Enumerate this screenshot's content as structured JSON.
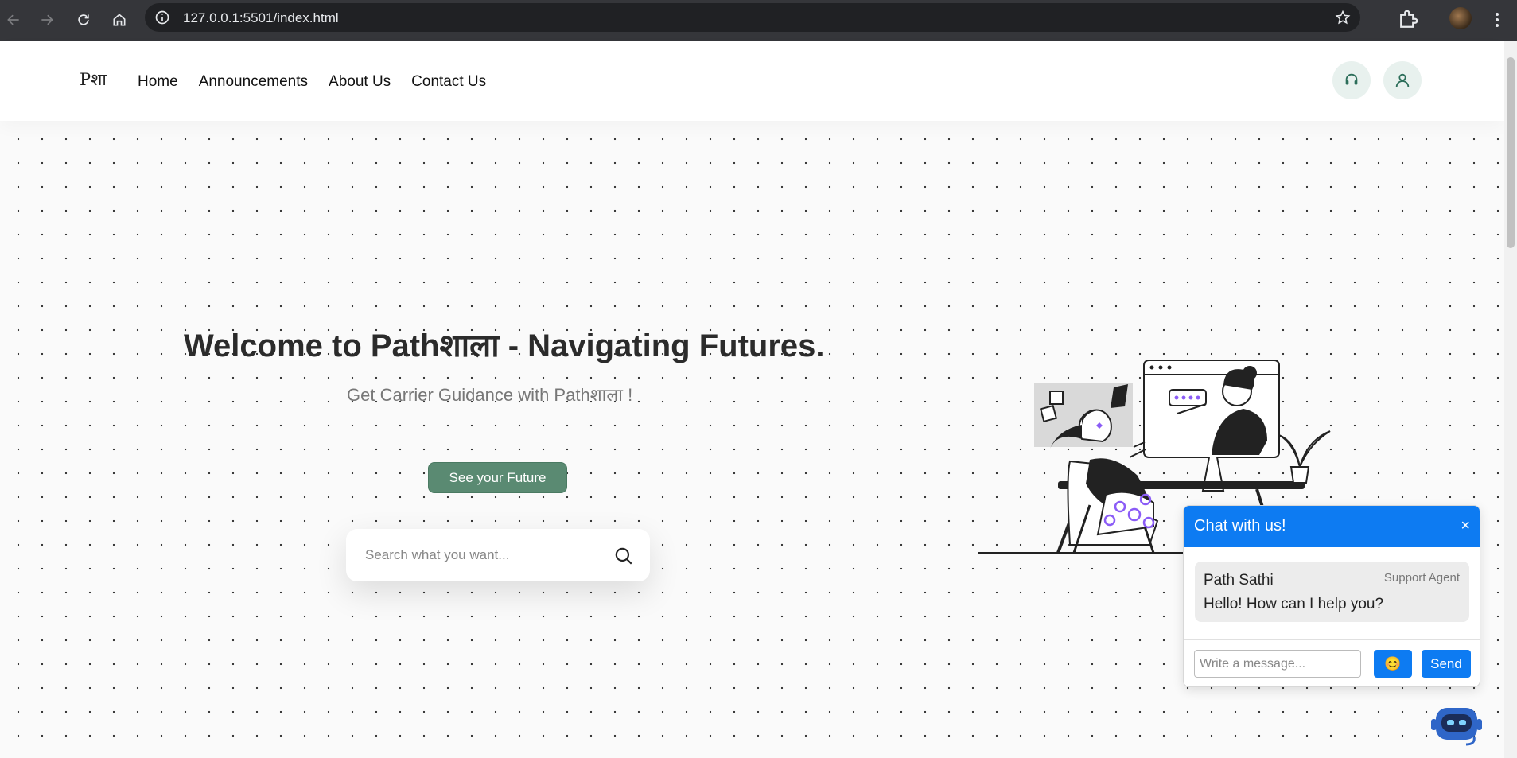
{
  "browser": {
    "url": "127.0.0.1:5501/index.html"
  },
  "site": {
    "logo_text": "Pशा",
    "nav": [
      {
        "label": "Home"
      },
      {
        "label": "Announcements"
      },
      {
        "label": "About Us"
      },
      {
        "label": "Contact Us"
      }
    ]
  },
  "hero": {
    "title": "Welcome to Pathशाला - Navigating Futures.",
    "subtitle": "Get Carrier Guidance with Pathशाला !",
    "cta_label": "See your Future",
    "search_placeholder": "Search what you want..."
  },
  "chat": {
    "title": "Chat with us!",
    "close_label": "×",
    "sender": "Path Sathi",
    "role": "Support Agent",
    "message": "Hello! How can I help you?",
    "input_placeholder": "Write a message...",
    "emoji_label": "😊",
    "send_label": "Send"
  },
  "colors": {
    "accent_green": "#5a8a72",
    "chat_blue": "#0d7bf2"
  }
}
